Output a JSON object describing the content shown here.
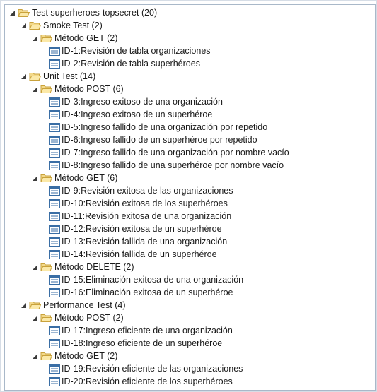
{
  "tree": {
    "root": {
      "label": "Test superheroes-topsecret (20)"
    },
    "smoke": {
      "label": "Smoke Test (2)",
      "get": {
        "label": "Método GET (2)",
        "cases": [
          "ID-1:Revisión de tabla organizaciones",
          "ID-2:Revisión de tabla superhéroes"
        ]
      }
    },
    "unit": {
      "label": "Unit Test (14)",
      "post": {
        "label": "Método POST (6)",
        "cases": [
          "ID-3:Ingreso exitoso de una organización",
          "ID-4:Ingreso exitoso de un superhéroe",
          "ID-5:Ingreso fallido de una organización por repetido",
          "ID-6:Ingreso fallido de un superhéroe por repetido",
          "ID-7:Ingreso fallido de una organización por nombre vacío",
          "ID-8:Ingreso fallido de una superhéroe por nombre vacío"
        ]
      },
      "get": {
        "label": "Método GET (6)",
        "cases": [
          "ID-9:Revisión exitosa de las organizaciones",
          "ID-10:Revisión exitosa de los superhéroes",
          "ID-11:Revisión exitosa de una organización",
          "ID-12:Revisión exitosa de un superhéroe",
          "ID-13:Revisión fallida de una organización",
          "ID-14:Revisión fallida de un superhéroe"
        ]
      },
      "delete": {
        "label": "Método DELETE (2)",
        "cases": [
          "ID-15:Eliminación exitosa de una organización",
          "ID-16:Eliminación exitosa de un superhéroe"
        ]
      }
    },
    "performance": {
      "label": "Performance Test (4)",
      "post": {
        "label": "Método POST (2)",
        "cases": [
          "ID-17:Ingreso eficiente de una organización",
          "ID-18:Ingreso eficiente de un superhéroe"
        ]
      },
      "get": {
        "label": "Método GET (2)",
        "cases": [
          "ID-19:Revisión eficiente de las organizaciones",
          "ID-20:Revisión eficiente de los superhéroes"
        ]
      }
    }
  },
  "icons": {
    "folder": "folder-open-icon",
    "test_case": "test-case-icon",
    "expand_toggle": "collapse-triangle-icon"
  },
  "colors": {
    "folder_fill": "#f3d98a",
    "folder_stroke": "#c9a23c",
    "case_stroke": "#3a6ea5",
    "border": "#a9b8c9"
  }
}
